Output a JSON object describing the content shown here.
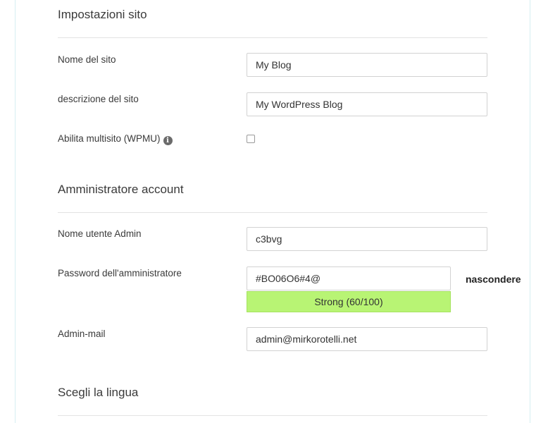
{
  "site_settings": {
    "title": "Impostazioni sito",
    "site_name_label": "Nome del sito",
    "site_name_value": "My Blog",
    "site_description_label": "descrizione del sito",
    "site_description_value": "My WordPress Blog",
    "multisite_label": "Abilita multisito (WPMU)",
    "multisite_checked": false,
    "info_icon": "info-circle-icon"
  },
  "admin_account": {
    "title": "Amministratore account",
    "username_label": "Nome utente Admin",
    "username_value": "c3bvg",
    "password_label": "Password dell'amministratore",
    "password_value": "#BO06O6#4@",
    "hide_label": "nascondere",
    "strength_text": "Strong (60/100)",
    "strength_color": "#b8f474",
    "email_label": "Admin-mail",
    "email_value": "admin@mirkorotelli.net"
  },
  "language": {
    "title": "Scegli la lingua"
  }
}
